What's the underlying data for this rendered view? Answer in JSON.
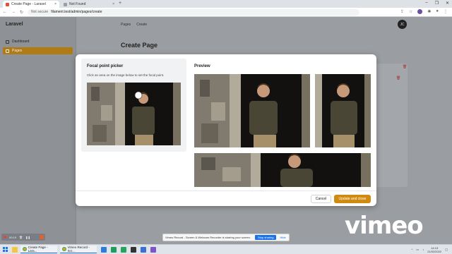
{
  "browser": {
    "tabs": [
      {
        "title": "Create Page - Laravel",
        "active": true
      },
      {
        "title": "Not Found",
        "active": false
      }
    ],
    "new_tab": "+",
    "window_controls": [
      "–",
      "❐",
      "✕"
    ],
    "not_secure": "Not secure",
    "url": "filament.test/admin/pages/create"
  },
  "app": {
    "brand": "Laravel",
    "nav": [
      {
        "label": "Dashboard",
        "active": false
      },
      {
        "label": "Pages",
        "active": true
      }
    ],
    "breadcrumbs": [
      "Pages",
      "Create"
    ],
    "avatar": "JC",
    "page_title": "Create Page"
  },
  "modal": {
    "picker_title": "Focal point picker",
    "picker_hint": "Click an area on the image below to set the focal point.",
    "preview_title": "Preview",
    "cancel_label": "Cancel",
    "update_label": "Update and close"
  },
  "recorder": {
    "time": "00:19"
  },
  "share_bar": {
    "message": "Vimeo Record - Screen & Webcam Recorder is sharing your screen.",
    "stop_label": "Stop sharing",
    "hide_label": "Hide"
  },
  "watermark": "vimeo",
  "taskbar": {
    "apps": [
      {
        "label": "Create Page - Lara..."
      },
      {
        "label": "Vimeo Record - Scr..."
      }
    ],
    "time": "14:13",
    "date": "21/02/2022"
  }
}
